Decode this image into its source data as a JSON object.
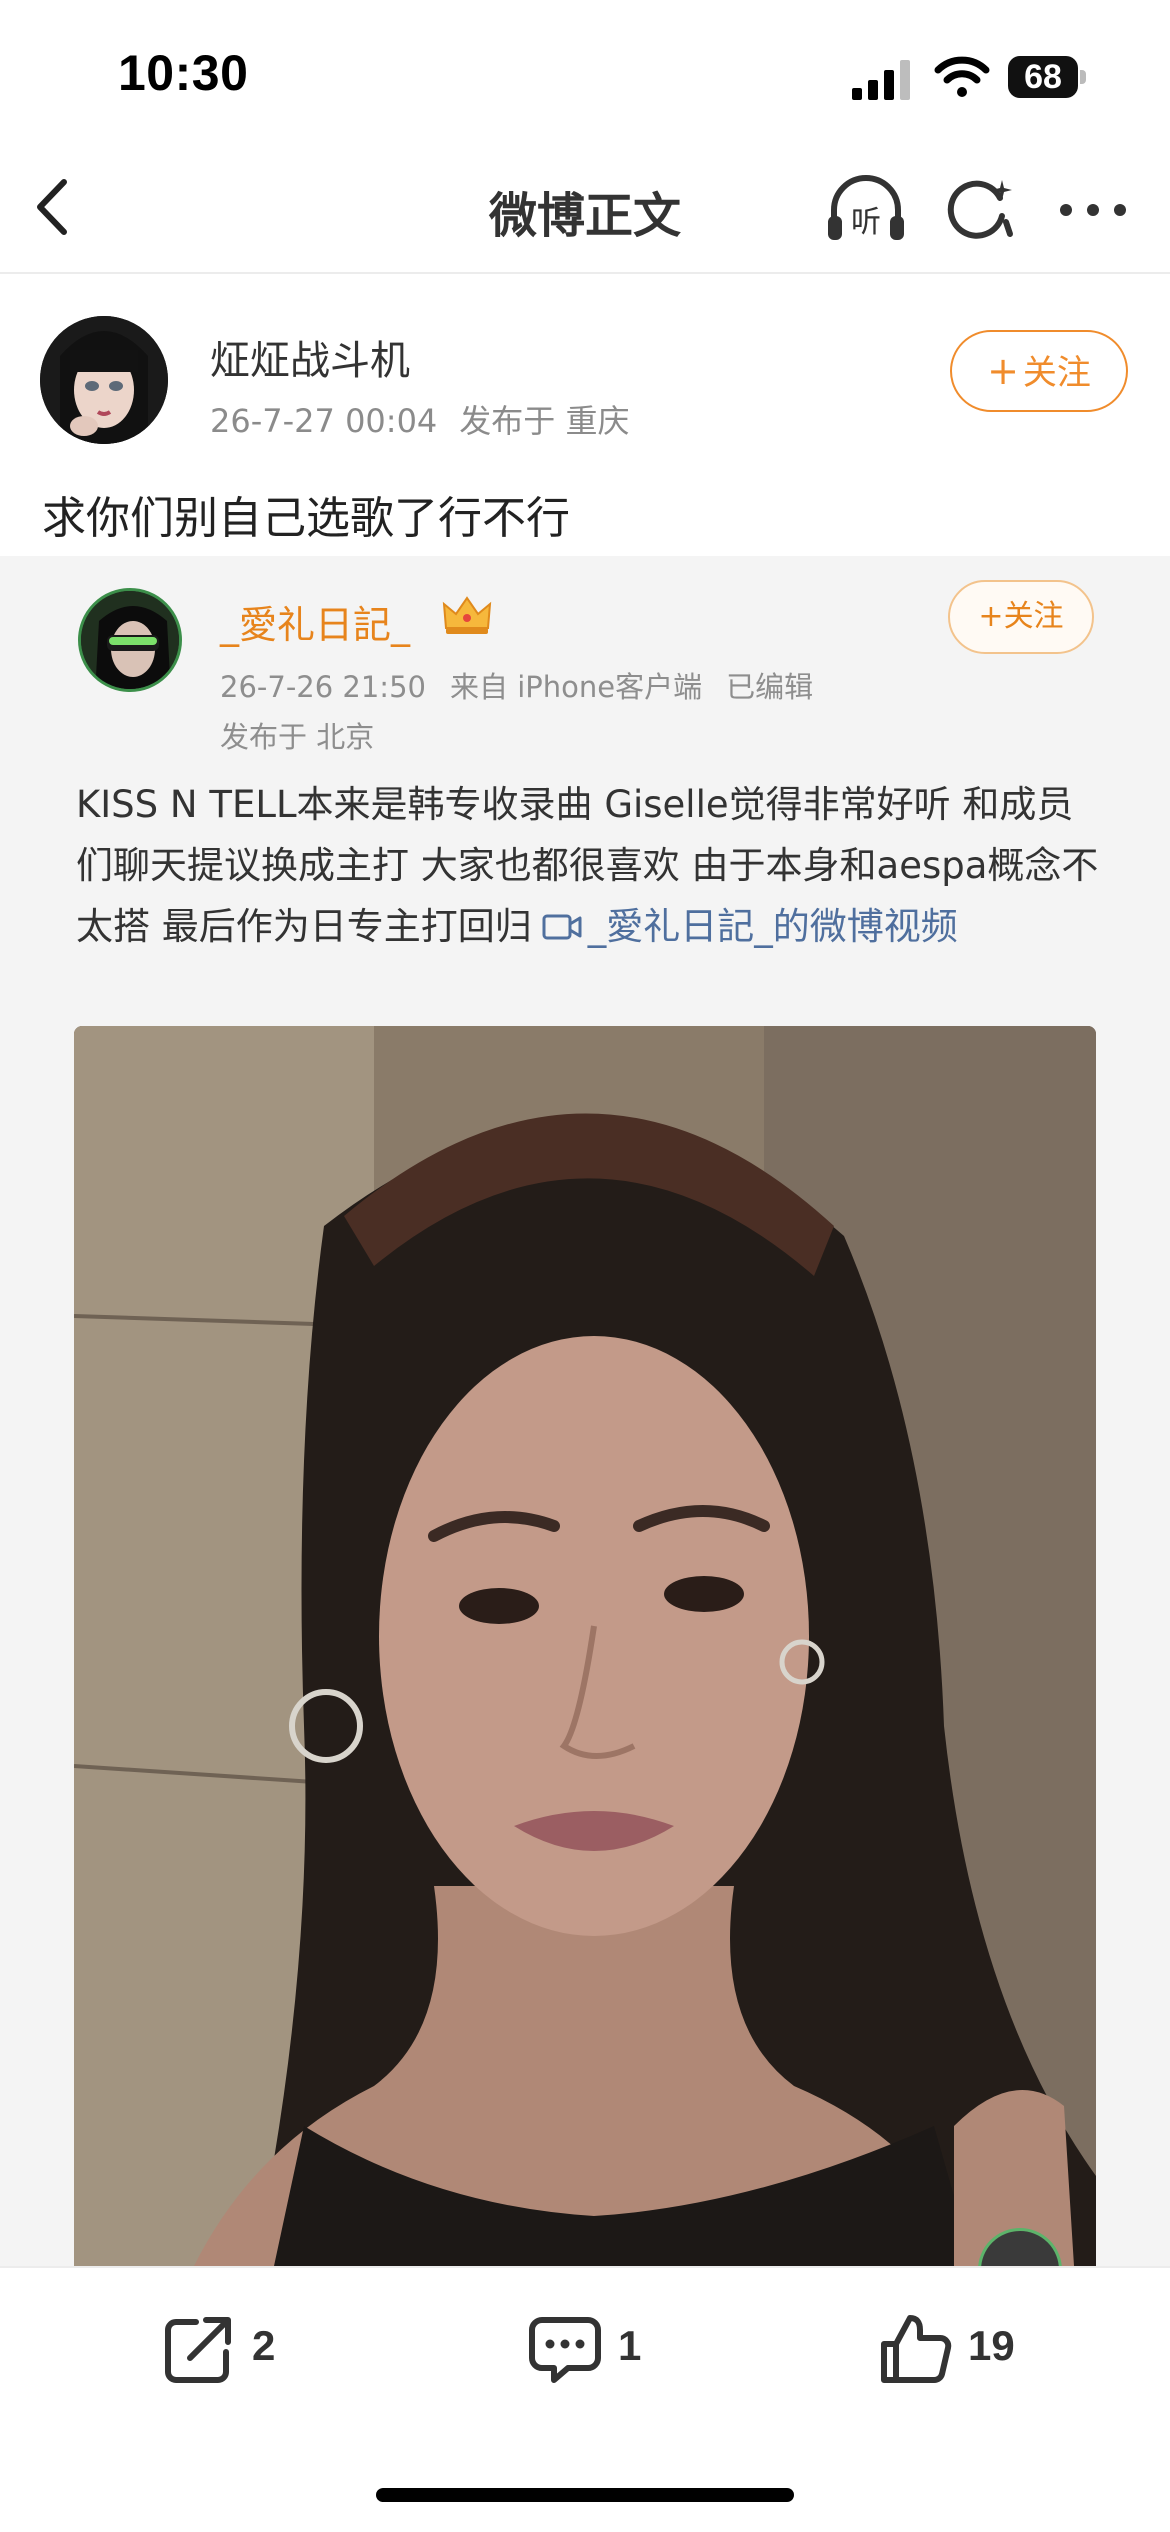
{
  "status_bar": {
    "time": "10:30",
    "battery": "68",
    "icons": [
      "signal-icon",
      "wifi-icon",
      "battery-icon"
    ]
  },
  "nav": {
    "title": "微博正文",
    "listen_label": "听",
    "icons": [
      "back-icon",
      "listen-icon",
      "refresh-icon",
      "more-icon"
    ]
  },
  "post": {
    "author": "炡炡战斗机",
    "timestamp": "26-7-27 00:04",
    "location": "发布于 重庆",
    "follow_label": "关注",
    "text": "求你们别自己选歌了行不行"
  },
  "retweet": {
    "author": "_愛礼日記_",
    "follow_label": "关注",
    "timestamp": "26-7-26 21:50",
    "source": "来自 iPhone客户端",
    "edited": "已编辑",
    "location": "发布于 北京",
    "body": "KISS N TELL本来是韩专收录曲 Giselle觉得非常好听 和成员们聊天提议换成主打 大家也都很喜欢 由于本身和aespa概念不太搭 最后作为日专主打回归",
    "video_link": "_愛礼日記_的微博视频"
  },
  "actions": {
    "repost_count": "2",
    "comment_count": "1",
    "like_count": "19"
  },
  "colors": {
    "accent_orange": "#f08c2c",
    "link_blue": "#4f6f9e",
    "card_bg": "#f4f4f4"
  }
}
